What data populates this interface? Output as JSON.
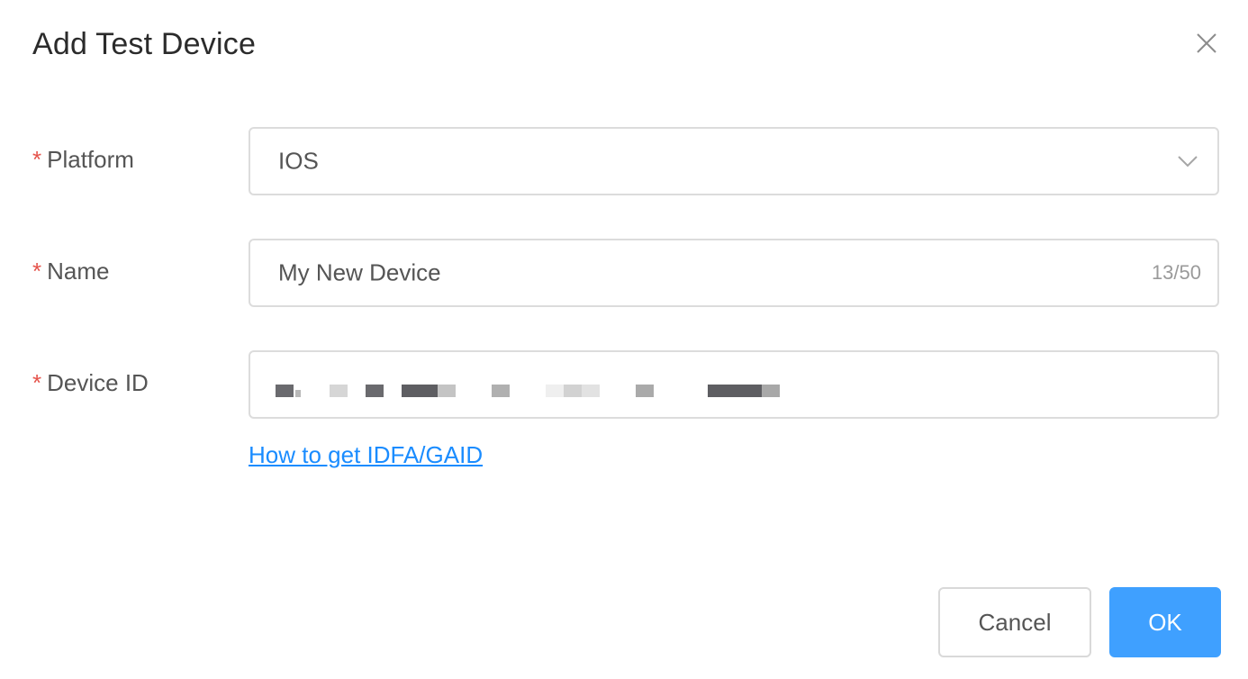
{
  "dialog": {
    "title": "Add Test Device"
  },
  "form": {
    "required_mark": "*",
    "platform": {
      "label": "Platform",
      "value": "IOS"
    },
    "name": {
      "label": "Name",
      "value": "My New Device",
      "counter": "13/50"
    },
    "device_id": {
      "label": "Device ID",
      "value": ""
    },
    "help_link": "How to get IDFA/GAID"
  },
  "footer": {
    "cancel_label": "Cancel",
    "ok_label": "OK"
  },
  "icons": {
    "close": "close-icon",
    "dropdown": "chevron-down-icon"
  },
  "colors": {
    "primary": "#3fa0ff",
    "link": "#1a8cff",
    "required": "#e5534b",
    "border": "#dcdcdc"
  }
}
